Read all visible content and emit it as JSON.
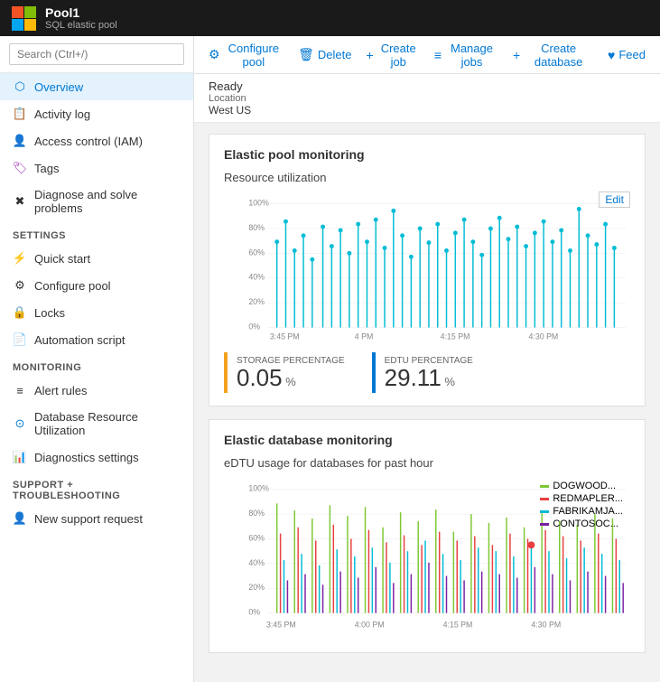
{
  "topbar": {
    "title": "Pool1",
    "subtitle": "SQL elastic pool",
    "logo_char": "▦"
  },
  "sidebar": {
    "search_placeholder": "Search (Ctrl+/)",
    "nav_items": [
      {
        "id": "overview",
        "label": "Overview",
        "icon": "⬡",
        "active": true,
        "color": "#0078d4"
      },
      {
        "id": "activity-log",
        "label": "Activity log",
        "icon": "📋",
        "active": false,
        "color": "#0078d4"
      },
      {
        "id": "access-control",
        "label": "Access control (IAM)",
        "icon": "👤",
        "active": false,
        "color": "#0078d4"
      },
      {
        "id": "tags",
        "label": "Tags",
        "icon": "🏷",
        "active": false,
        "color": "#9c27b0"
      },
      {
        "id": "diagnose",
        "label": "Diagnose and solve problems",
        "icon": "✖",
        "active": false,
        "color": "#333"
      }
    ],
    "sections": [
      {
        "label": "SETTINGS",
        "items": [
          {
            "id": "quick-start",
            "label": "Quick start",
            "icon": "⚡",
            "color": "#0078d4"
          },
          {
            "id": "configure-pool",
            "label": "Configure pool",
            "icon": "⚙",
            "color": "#333"
          },
          {
            "id": "locks",
            "label": "Locks",
            "icon": "🔒",
            "color": "#333"
          },
          {
            "id": "automation-script",
            "label": "Automation script",
            "icon": "📄",
            "color": "#0078d4"
          }
        ]
      },
      {
        "label": "MONITORING",
        "items": [
          {
            "id": "alert-rules",
            "label": "Alert rules",
            "icon": "≡",
            "color": "#333"
          },
          {
            "id": "db-resource",
            "label": "Database Resource Utilization",
            "icon": "⊙",
            "color": "#0078d4"
          },
          {
            "id": "diagnostics",
            "label": "Diagnostics settings",
            "icon": "📊",
            "color": "#0078d4"
          }
        ]
      },
      {
        "label": "SUPPORT + TROUBLESHOOTING",
        "items": [
          {
            "id": "new-support",
            "label": "New support request",
            "icon": "👤",
            "color": "#0078d4"
          }
        ]
      }
    ]
  },
  "toolbar": {
    "buttons": [
      {
        "id": "configure-pool",
        "label": "Configure pool",
        "icon": "⚙"
      },
      {
        "id": "delete",
        "label": "Delete",
        "icon": "🗑"
      },
      {
        "id": "create-job",
        "label": "Create job",
        "icon": "+"
      },
      {
        "id": "manage-jobs",
        "label": "Manage jobs",
        "icon": "≡"
      },
      {
        "id": "create-database",
        "label": "Create database",
        "icon": "+"
      },
      {
        "id": "feed",
        "label": "Feed",
        "icon": "♥"
      }
    ]
  },
  "status": {
    "ready_text": "Ready",
    "location_label": "Location",
    "location_value": "West US"
  },
  "elastic_pool_monitoring": {
    "section_title": "Elastic pool monitoring",
    "chart_title": "Resource utilization",
    "edit_label": "Edit",
    "time_labels": [
      "3:45 PM",
      "4 PM",
      "4:15 PM",
      "4:30 PM"
    ],
    "y_labels": [
      "100%",
      "80%",
      "60%",
      "40%",
      "20%",
      "0%"
    ],
    "metrics": [
      {
        "id": "storage",
        "label": "STORAGE PERCENTAGE",
        "value": "0.05",
        "unit": "%",
        "color": "#f4a222"
      },
      {
        "id": "edtu",
        "label": "EDTU PERCENTAGE",
        "value": "29.11",
        "unit": "%",
        "color": "#0078d4"
      }
    ]
  },
  "elastic_db_monitoring": {
    "section_title": "Elastic database monitoring",
    "chart_title": "eDTU usage for databases for past hour",
    "time_labels": [
      "3:45 PM",
      "4:00 PM",
      "4:15 PM",
      "4:30 PM"
    ],
    "y_labels": [
      "100%",
      "80%",
      "60%",
      "40%",
      "20%",
      "0%"
    ],
    "legend": [
      {
        "id": "dogwood",
        "label": "DOGWOOD...",
        "color": "#7dc832"
      },
      {
        "id": "redmapler",
        "label": "REDMAPLER...",
        "color": "#e84040"
      },
      {
        "id": "fabrikamja",
        "label": "FABRIKAMJA...",
        "color": "#00bcd4"
      },
      {
        "id": "contosoc",
        "label": "CONTOSOC...",
        "color": "#7b1fa2"
      }
    ]
  }
}
